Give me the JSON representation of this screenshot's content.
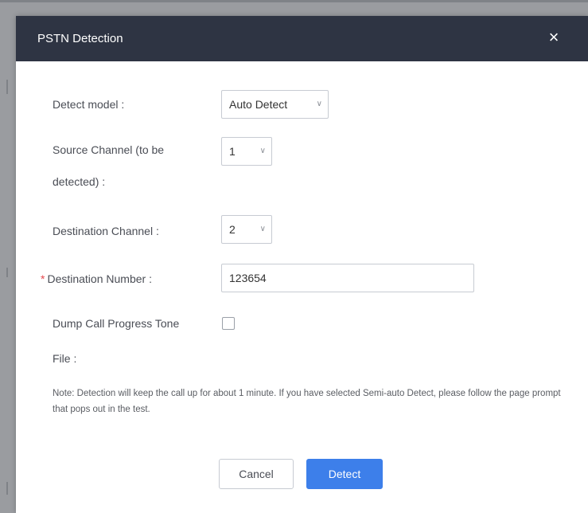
{
  "dialog": {
    "title": "PSTN Detection",
    "close_glyph": "×"
  },
  "form": {
    "detect_model": {
      "label": "Detect model :",
      "value": "Auto Detect"
    },
    "source_channel": {
      "label_line1": "Source Channel (to be",
      "label_line2": "detected) :",
      "value": "1"
    },
    "destination_channel": {
      "label": "Destination Channel :",
      "value": "2"
    },
    "destination_number": {
      "required_mark": "*",
      "label": "Destination Number :",
      "value": "123654"
    },
    "dump_call_progress": {
      "label_line1": "Dump Call Progress Tone",
      "label_line2": "File :",
      "checked": false
    }
  },
  "note": "Note: Detection will keep the call up for about 1 minute. If you have selected Semi-auto Detect, please follow the page prompt that pops out in the test.",
  "buttons": {
    "cancel": "Cancel",
    "detect": "Detect"
  },
  "icons": {
    "chevron": "chevron-down-icon",
    "close": "close-icon"
  },
  "colors": {
    "titlebar": "#2e3443",
    "primary": "#3d7fea",
    "required": "#e5484d"
  }
}
